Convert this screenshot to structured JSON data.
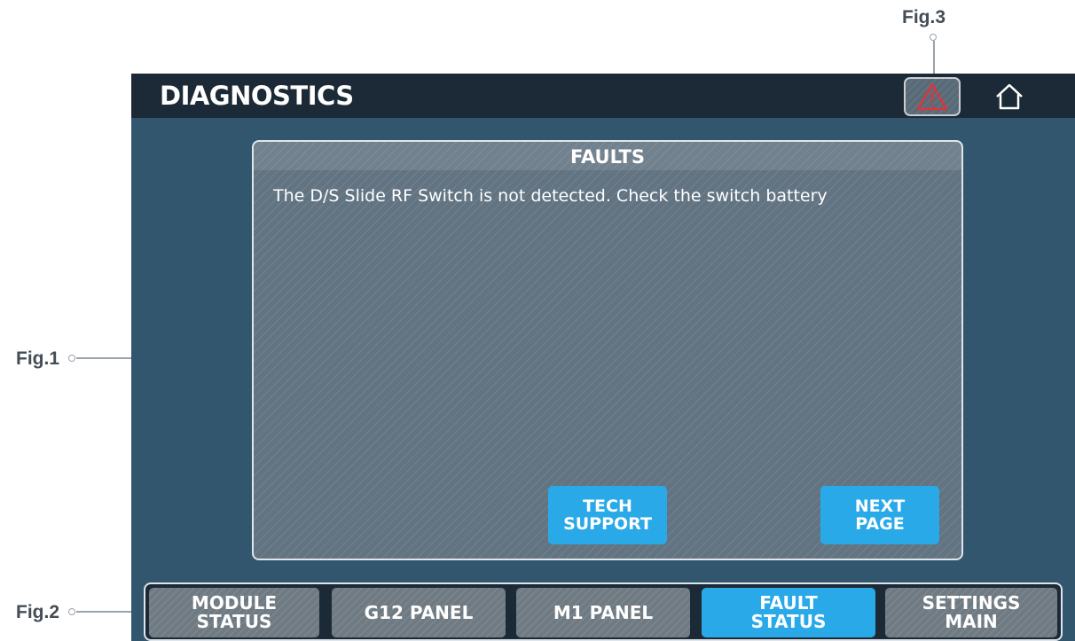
{
  "header": {
    "title": "DIAGNOSTICS",
    "warning_icon": "warning-triangle-icon",
    "home_icon": "home-icon"
  },
  "panel": {
    "title": "FAULTS",
    "message": "The D/S Slide RF Switch is not detected. Check the switch battery",
    "tech_support_label": "TECH\nSUPPORT",
    "next_page_label": "NEXT\nPAGE"
  },
  "nav": {
    "items": [
      {
        "label": "MODULE\nSTATUS",
        "active": false
      },
      {
        "label": "G12 PANEL",
        "active": false
      },
      {
        "label": "M1 PANEL",
        "active": false
      },
      {
        "label": "FAULT\nSTATUS",
        "active": true
      },
      {
        "label": "SETTINGS\nMAIN",
        "active": false
      }
    ]
  },
  "annotations": {
    "fig1": "Fig.1",
    "fig2": "Fig.2",
    "fig3": "Fig.3"
  },
  "colors": {
    "screen_bg": "#33566f",
    "titlebar_bg": "#1b2a36",
    "accent_blue": "#29a9e8",
    "warning_red": "#d9363e"
  }
}
